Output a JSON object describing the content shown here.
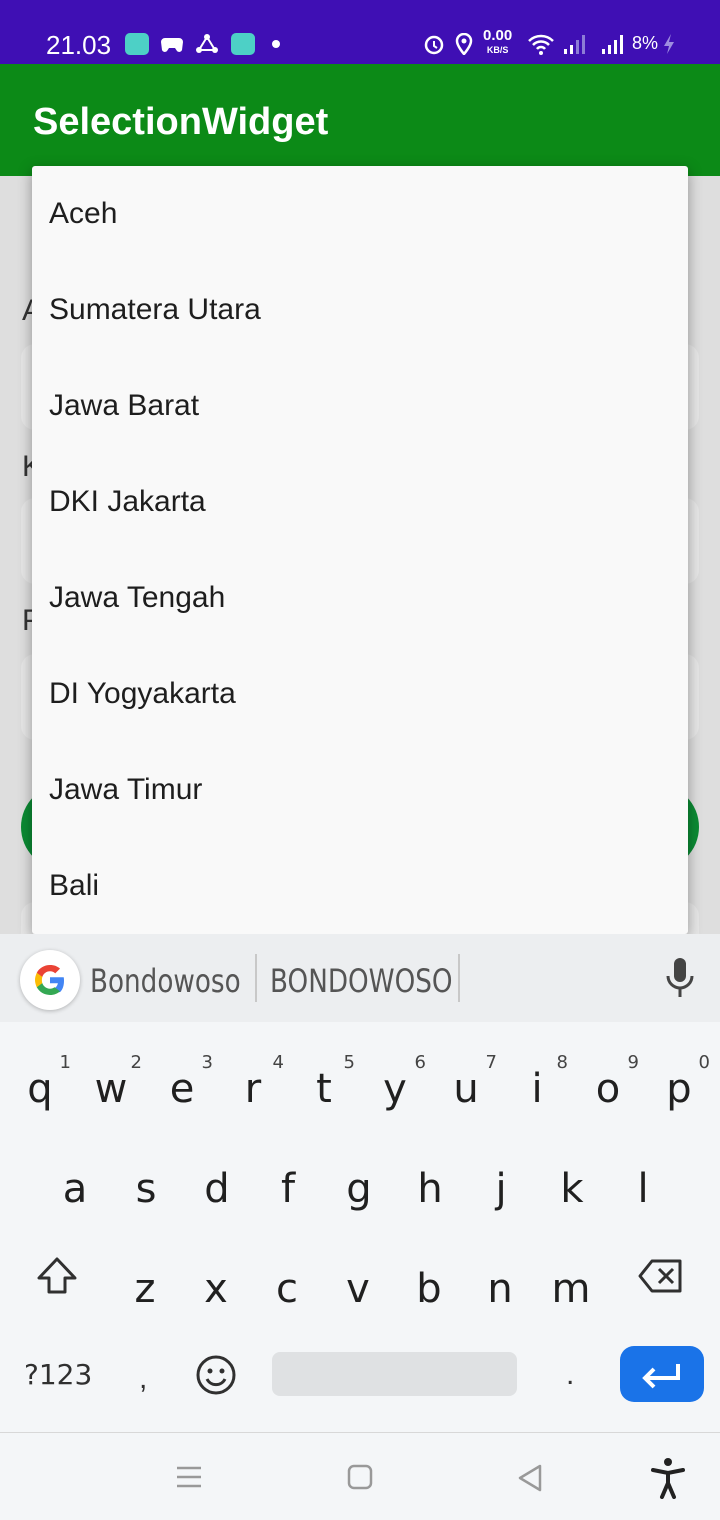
{
  "status_bar": {
    "time": "21.03",
    "net_speed_value": "0.00",
    "net_speed_unit": "KB/S",
    "battery": "8%"
  },
  "app_bar": {
    "title": "SelectionWidget"
  },
  "dropdown": {
    "options": [
      "Aceh",
      "Sumatera Utara",
      "Jawa Barat",
      "DKI Jakarta",
      "Jawa Tengah",
      "DI Yogyakarta",
      "Jawa Timur",
      "Bali"
    ]
  },
  "keyboard": {
    "suggestions": [
      "Bondowoso",
      "BONDOWOSO"
    ],
    "row1": [
      {
        "l": "q",
        "n": "1"
      },
      {
        "l": "w",
        "n": "2"
      },
      {
        "l": "e",
        "n": "3"
      },
      {
        "l": "r",
        "n": "4"
      },
      {
        "l": "t",
        "n": "5"
      },
      {
        "l": "y",
        "n": "6"
      },
      {
        "l": "u",
        "n": "7"
      },
      {
        "l": "i",
        "n": "8"
      },
      {
        "l": "o",
        "n": "9"
      },
      {
        "l": "p",
        "n": "0"
      }
    ],
    "row2": [
      "a",
      "s",
      "d",
      "f",
      "g",
      "h",
      "j",
      "k",
      "l"
    ],
    "row3": [
      "z",
      "x",
      "c",
      "v",
      "b",
      "n",
      "m"
    ],
    "symbols_key": "?123",
    "comma_key": ",",
    "period_key": ".",
    "accent_color": "#1a73e8"
  },
  "colors": {
    "status_bar": "#3f0fb4",
    "app_bar": "#0c8a17"
  }
}
